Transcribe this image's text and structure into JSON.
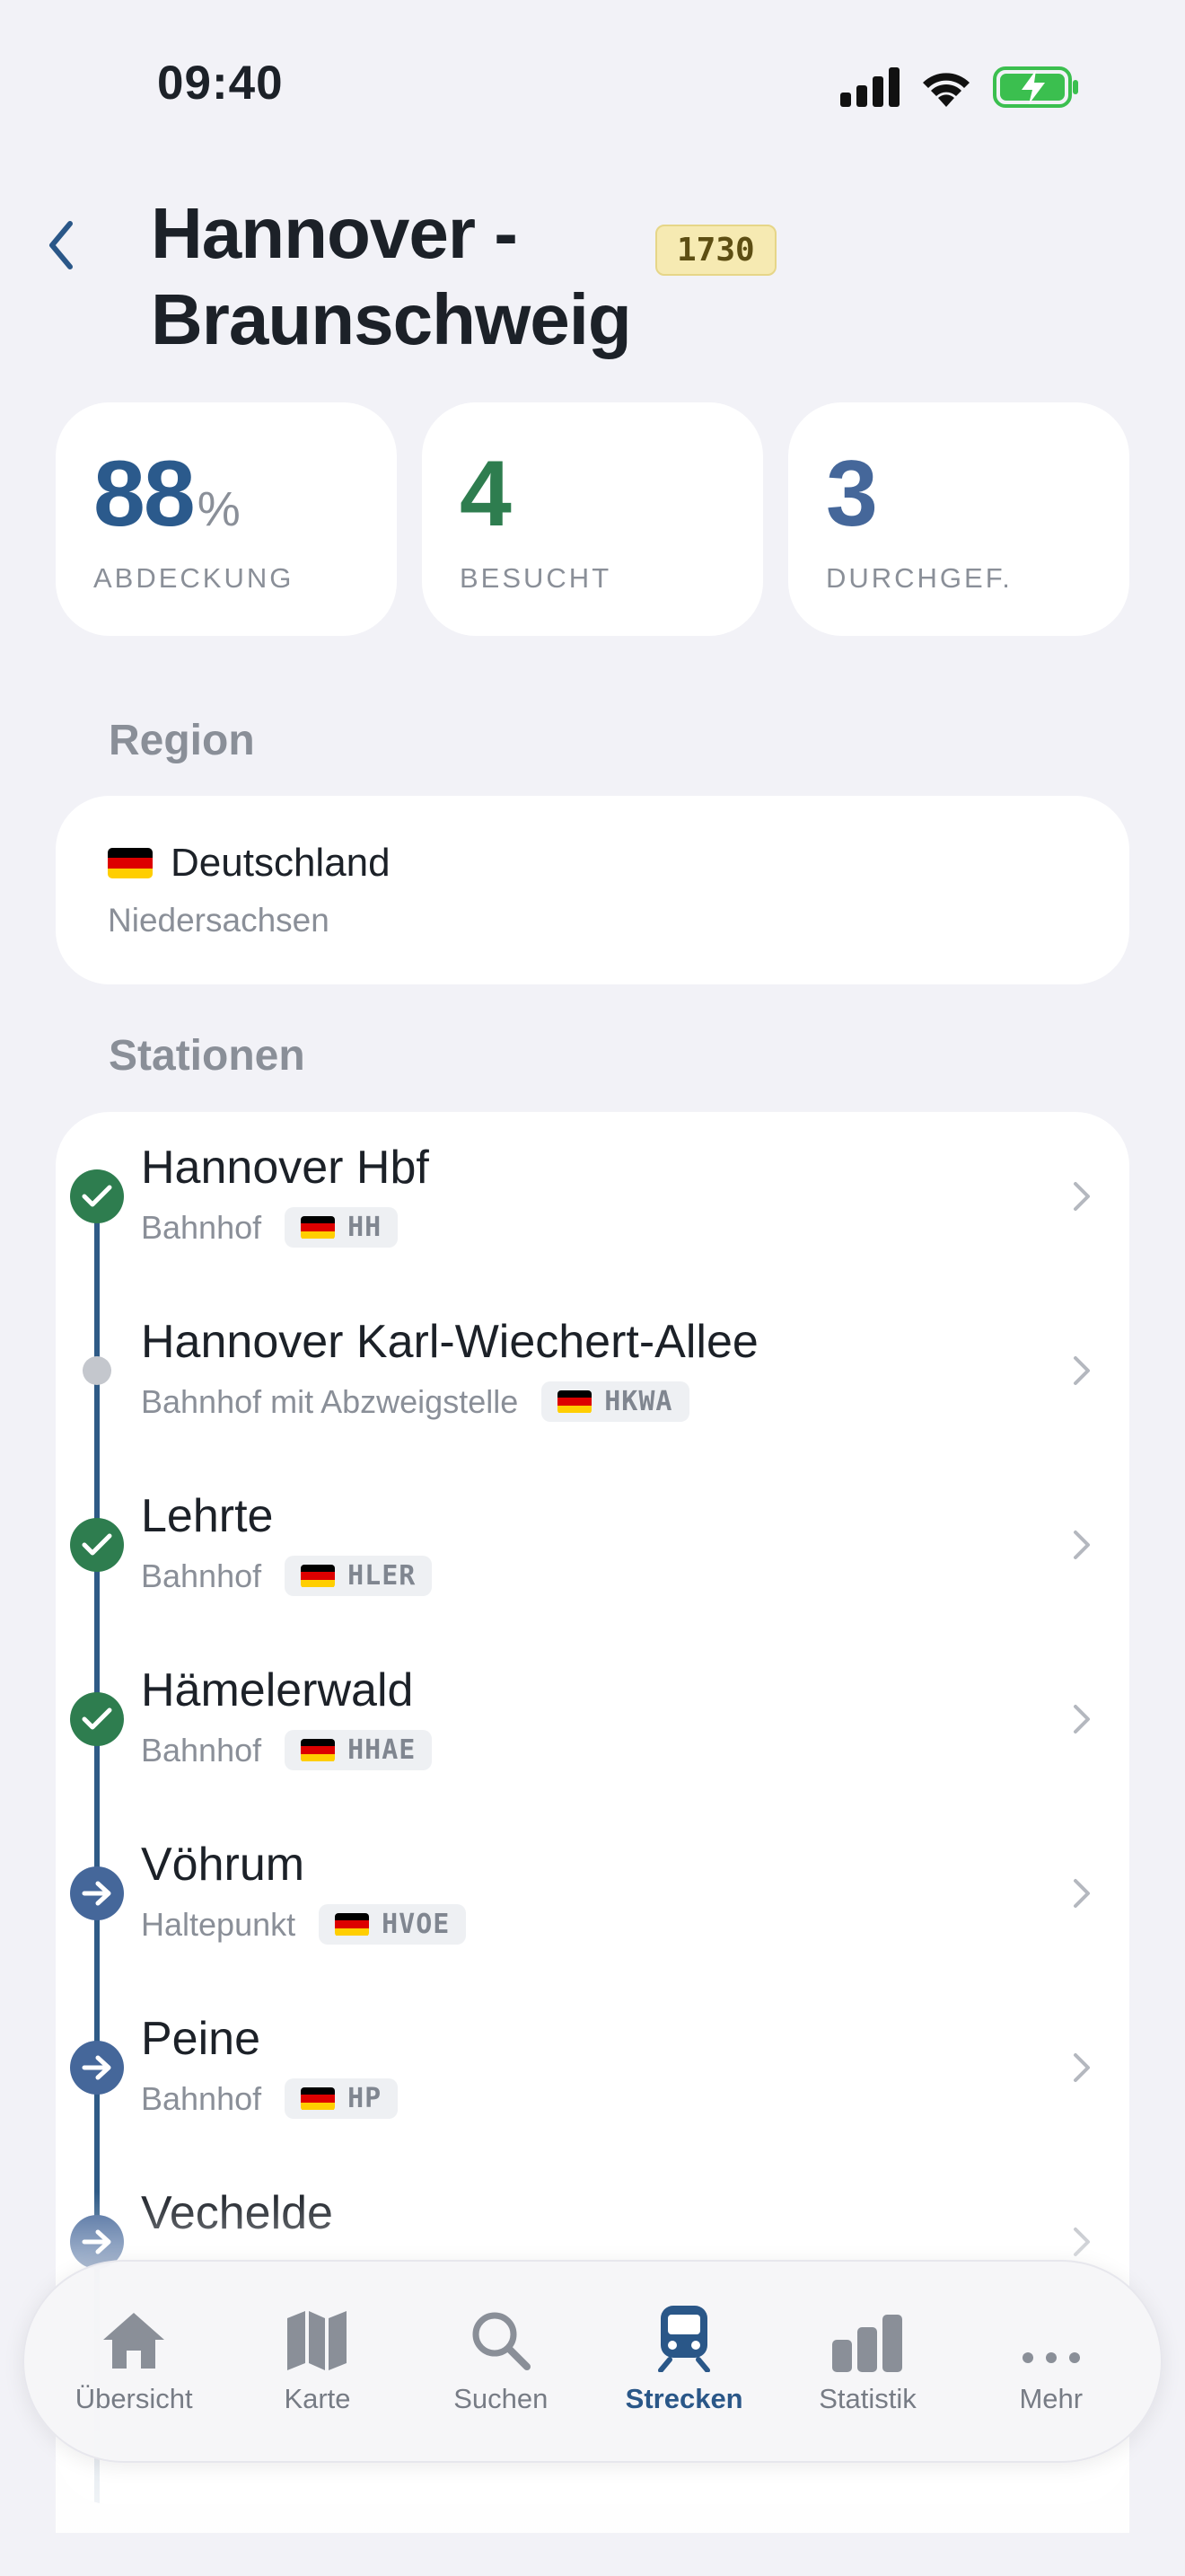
{
  "status_bar": {
    "time": "09:40"
  },
  "header": {
    "title": "Hannover - Braunschweig",
    "route_number": "1730"
  },
  "stats": [
    {
      "value": "88",
      "unit": "%",
      "label": "ABDECKUNG",
      "color": "#2b5a8c"
    },
    {
      "value": "4",
      "unit": "",
      "label": "BESUCHT",
      "color": "#2e7d4f"
    },
    {
      "value": "3",
      "unit": "",
      "label": "DURCHGEF.",
      "color": "#45679a"
    }
  ],
  "region": {
    "header": "Region",
    "country": "Deutschland",
    "state": "Niedersachsen"
  },
  "stations": {
    "header": "Stationen",
    "items": [
      {
        "name": "Hannover Hbf",
        "type": "Bahnhof",
        "code": "HH",
        "status": "visited"
      },
      {
        "name": "Hannover Karl-Wiechert-Allee",
        "type": "Bahnhof mit Abzweigstelle",
        "code": "HKWA",
        "status": "unvisited"
      },
      {
        "name": "Lehrte",
        "type": "Bahnhof",
        "code": "HLER",
        "status": "visited"
      },
      {
        "name": "Hämelerwald",
        "type": "Bahnhof",
        "code": "HHAE",
        "status": "visited"
      },
      {
        "name": "Vöhrum",
        "type": "Haltepunkt",
        "code": "HVOE",
        "status": "passed"
      },
      {
        "name": "Peine",
        "type": "Bahnhof",
        "code": "HP",
        "status": "passed"
      },
      {
        "name": "Vechelde",
        "type": "",
        "code": "",
        "status": "passed"
      }
    ]
  },
  "tab_bar": {
    "active": "Strecken",
    "items": [
      {
        "label": "Übersicht",
        "icon": "house-icon"
      },
      {
        "label": "Karte",
        "icon": "map-icon"
      },
      {
        "label": "Suchen",
        "icon": "magnifier-icon"
      },
      {
        "label": "Strecken",
        "icon": "train-icon"
      },
      {
        "label": "Statistik",
        "icon": "bar-chart-icon"
      },
      {
        "label": "Mehr",
        "icon": "ellipsis-icon"
      }
    ]
  }
}
